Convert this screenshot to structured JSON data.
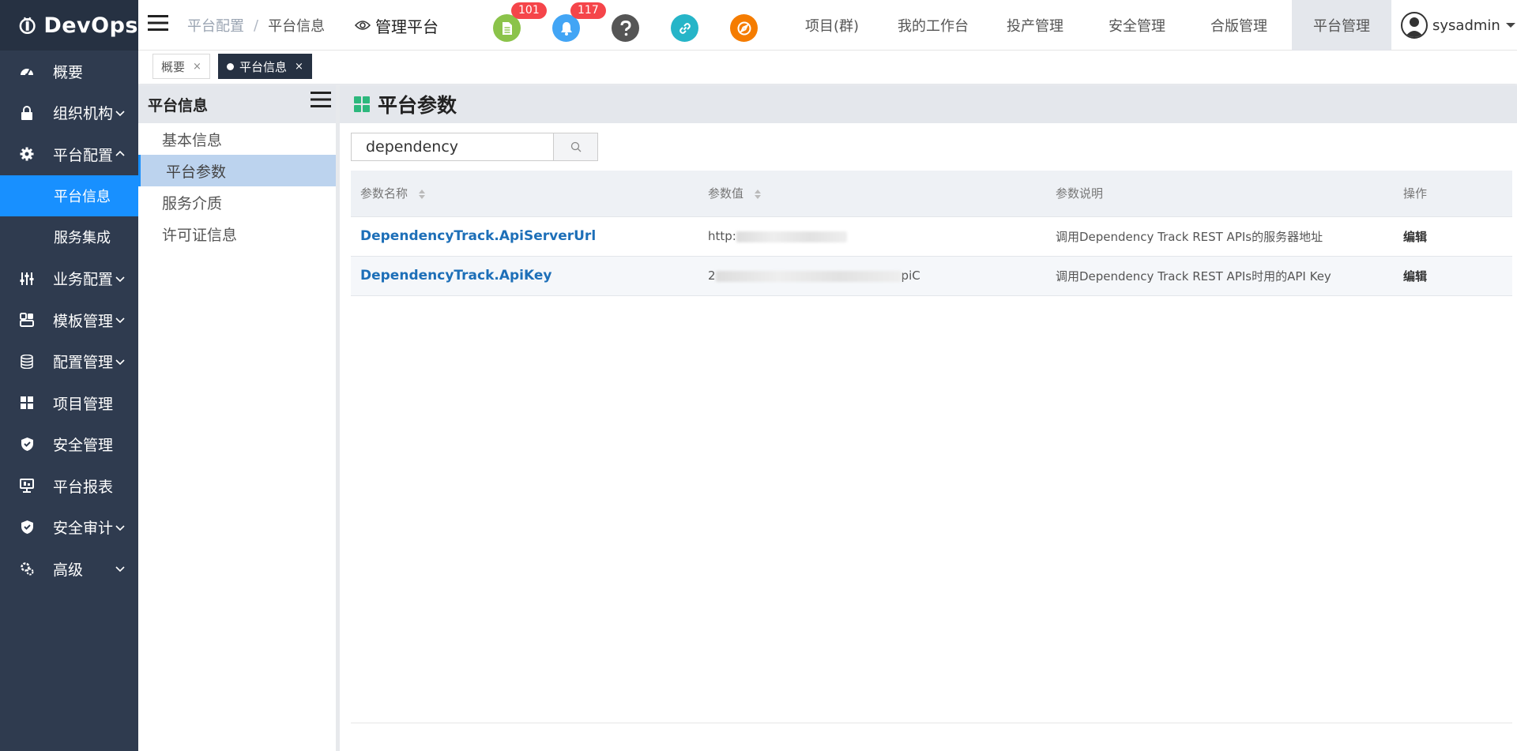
{
  "app": {
    "name": "DevOps"
  },
  "sidebar": {
    "items": [
      {
        "label": "概要"
      },
      {
        "label": "组织机构"
      },
      {
        "label": "平台配置"
      },
      {
        "label": "平台信息"
      },
      {
        "label": "服务集成"
      },
      {
        "label": "业务配置"
      },
      {
        "label": "模板管理"
      },
      {
        "label": "配置管理"
      },
      {
        "label": "项目管理"
      },
      {
        "label": "安全管理"
      },
      {
        "label": "平台报表"
      },
      {
        "label": "安全审计"
      },
      {
        "label": "高级"
      }
    ]
  },
  "header": {
    "breadcrumb": {
      "parent": "平台配置",
      "separator": "/",
      "current": "平台信息"
    },
    "mgmt_label": "管理平台",
    "doc_badge": "101",
    "bell_badge": "117",
    "menus": [
      {
        "label": "项目(群)"
      },
      {
        "label": "我的工作台"
      },
      {
        "label": "投产管理"
      },
      {
        "label": "安全管理"
      },
      {
        "label": "合版管理"
      },
      {
        "label": "平台管理"
      }
    ],
    "user": "sysadmin"
  },
  "tabs": [
    {
      "label": "概要",
      "close": "×"
    },
    {
      "label": "平台信息",
      "close": "×"
    }
  ],
  "submenu": {
    "title": "平台信息",
    "items": [
      {
        "label": "基本信息"
      },
      {
        "label": "平台参数"
      },
      {
        "label": "服务介质"
      },
      {
        "label": "许可证信息"
      }
    ]
  },
  "content": {
    "title": "平台参数",
    "search": {
      "value": "dependency"
    },
    "table": {
      "headers": {
        "name": "参数名称",
        "value": "参数值",
        "desc": "参数说明",
        "action": "操作"
      },
      "rows": [
        {
          "name": "DependencyTrack.ApiServerUrl",
          "value_prefix": "http:",
          "value_suffix": "",
          "desc": "调用Dependency Track REST APIs的服务器地址",
          "action": "编辑"
        },
        {
          "name": "DependencyTrack.ApiKey",
          "value_prefix": "2",
          "value_suffix": "piC",
          "desc": "调用Dependency Track REST APIs时用的API Key",
          "action": "编辑"
        }
      ]
    }
  },
  "colors": {
    "sidebar_bg": "#2f3b4f",
    "accent": "#1890ff",
    "badge_red": "#f5454a",
    "link_blue": "#1d6fb8",
    "icon_green": "#8bc34a",
    "icon_blue": "#42a5f5",
    "icon_dark": "#555555",
    "icon_teal": "#26b5c8",
    "icon_orange": "#f57c00"
  },
  "icons": [
    "dashboard-icon",
    "lock-icon",
    "gear-icon",
    "sliders-icon",
    "template-icon",
    "database-icon",
    "grid-icon",
    "shield-icon",
    "monitor-icon",
    "audit-shield-icon",
    "advanced-gear-icon",
    "document-icon",
    "bell-icon",
    "help-icon",
    "link-icon",
    "compass-icon",
    "eye-icon",
    "user-avatar-icon",
    "search-icon",
    "sort-icon"
  ]
}
